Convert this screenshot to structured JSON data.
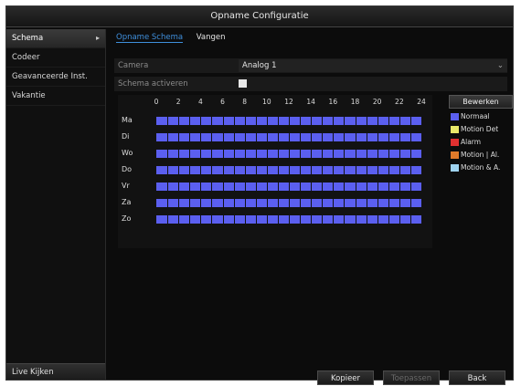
{
  "window": {
    "title": "Opname Configuratie"
  },
  "sidebar": {
    "items": [
      {
        "label": "Schema",
        "active": true
      },
      {
        "label": "Codeer"
      },
      {
        "label": "Geavanceerde Inst."
      },
      {
        "label": "Vakantie"
      }
    ],
    "live_label": "Live Kijken"
  },
  "tabs": [
    {
      "label": "Opname Schema",
      "active": true
    },
    {
      "label": "Vangen"
    }
  ],
  "form": {
    "camera_label": "Camera",
    "camera_value": "Analog 1",
    "enable_label": "Schema activeren"
  },
  "schedule": {
    "hours": [
      "0",
      "2",
      "4",
      "6",
      "8",
      "10",
      "12",
      "14",
      "16",
      "18",
      "20",
      "22",
      "24"
    ],
    "days": [
      "Ma",
      "Di",
      "Wo",
      "Do",
      "Vr",
      "Za",
      "Zo"
    ]
  },
  "legend": {
    "edit_label": "Bewerken",
    "items": [
      {
        "label": "Normaal",
        "color": "#5b5ff0"
      },
      {
        "label": "Motion Det",
        "color": "#e8e86a"
      },
      {
        "label": "Alarm",
        "color": "#e03030"
      },
      {
        "label": "Motion | Al.",
        "color": "#e07a2a"
      },
      {
        "label": "Motion & A.",
        "color": "#9fd3f0"
      }
    ]
  },
  "buttons": {
    "copy": "Kopieer",
    "apply": "Toepassen",
    "back": "Back"
  }
}
